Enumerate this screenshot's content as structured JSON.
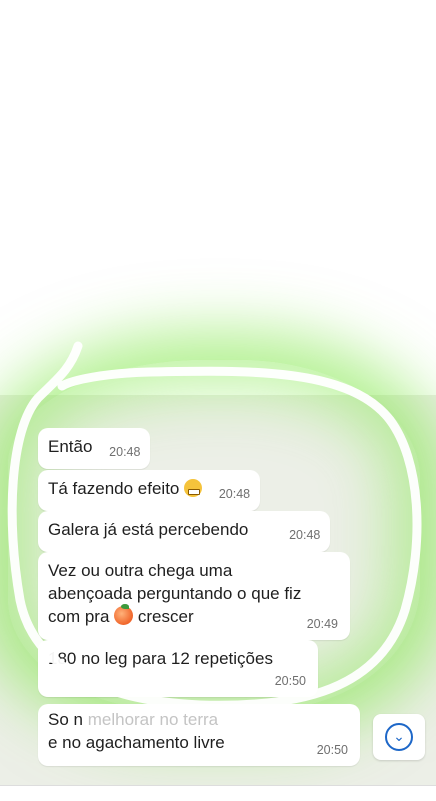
{
  "messages": [
    {
      "id": "m1",
      "text": "Então",
      "time": "20:48"
    },
    {
      "id": "m2",
      "text": "Tá fazendo efeito",
      "emoji": "grimace-emoji",
      "time": "20:48"
    },
    {
      "id": "m3",
      "text": "Galera já está percebendo",
      "time": "20:48"
    },
    {
      "id": "m4",
      "line1": "Vez ou outra chega uma",
      "line2": "abençoada perguntando o que fiz",
      "line3_a": "com pra",
      "emoji": "peach-emoji",
      "line3_b": "crescer",
      "time": "20:49"
    },
    {
      "id": "m5",
      "text": "180 no leg para 12 repetições",
      "time": "20:50"
    },
    {
      "id": "m6",
      "line1": "So n",
      "line1_hidden": "... terra",
      "line1_right": "melhorar no terra",
      "line2": "e no agachamento livre",
      "time": "20:50"
    }
  ],
  "scroll_button": {
    "icon": "chevron-down-icon"
  },
  "colors": {
    "highlight": "#7be34a",
    "accent": "#1d67c8",
    "chat_bg": "#ecefe7"
  }
}
